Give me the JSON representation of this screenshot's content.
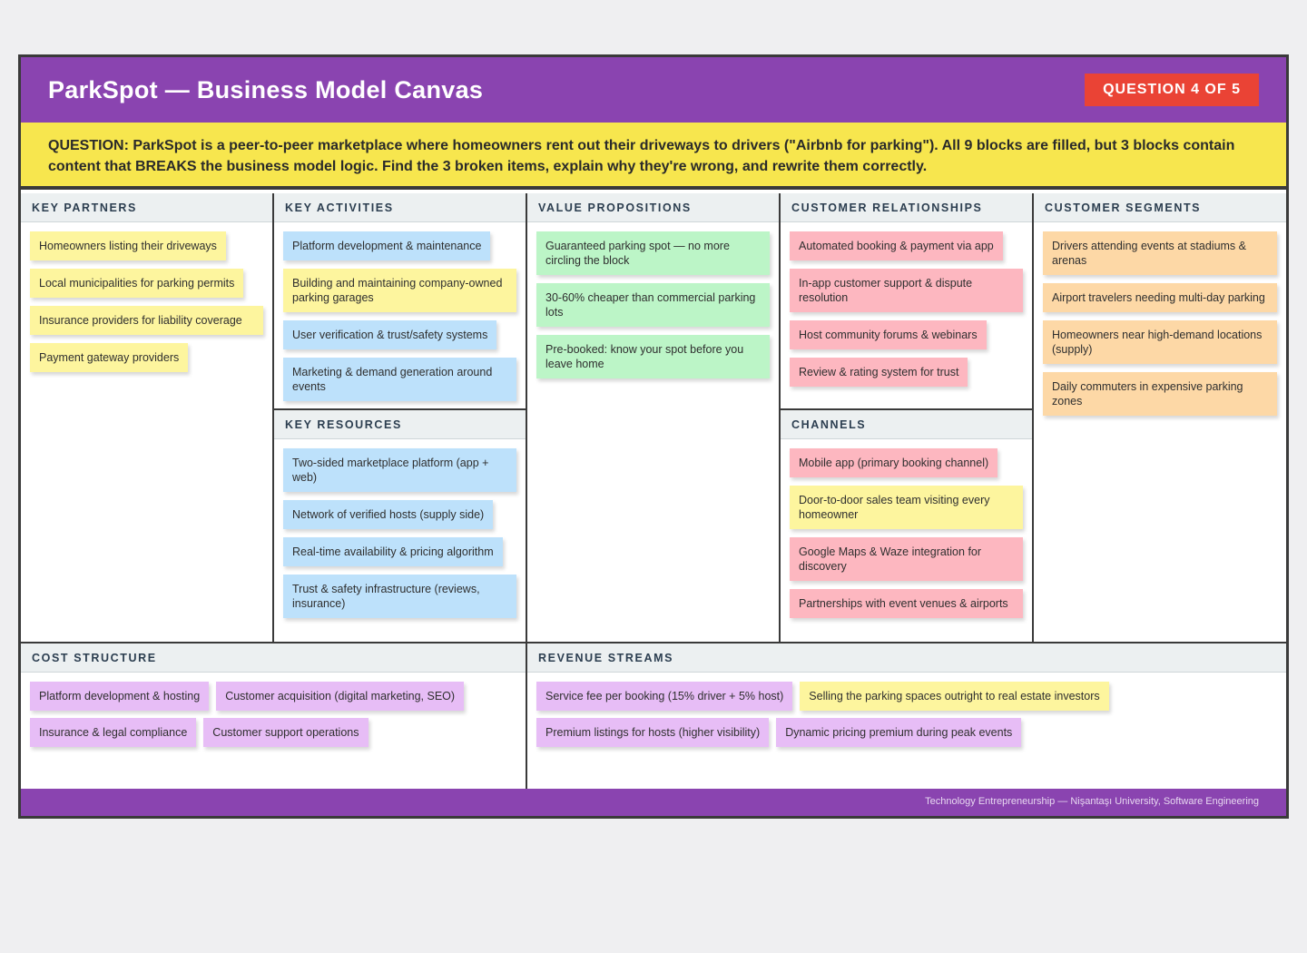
{
  "header": {
    "title": "ParkSpot — Business Model Canvas",
    "badge": "QUESTION 4 OF 5"
  },
  "question": "QUESTION: ParkSpot is a peer-to-peer marketplace where homeowners rent out their driveways to drivers (\"Airbnb for parking\"). All 9 blocks are filled, but 3 blocks contain content that BREAKS the business model logic. Find the 3 broken items, explain why they're wrong, and rewrite them correctly.",
  "blocks": {
    "key_partners": {
      "title": "KEY PARTNERS",
      "notes": [
        "Homeowners listing their driveways",
        "Local municipalities for parking permits",
        "Insurance providers for liability coverage",
        "Payment gateway providers"
      ]
    },
    "key_activities": {
      "title": "KEY ACTIVITIES",
      "notes": [
        "Platform development & maintenance",
        "Building and maintaining company-owned parking garages",
        "User verification & trust/safety systems",
        "Marketing & demand generation around events"
      ]
    },
    "key_resources": {
      "title": "KEY RESOURCES",
      "notes": [
        "Two-sided marketplace platform (app + web)",
        "Network of verified hosts (supply side)",
        "Real-time availability & pricing algorithm",
        "Trust & safety infrastructure (reviews, insurance)"
      ]
    },
    "value_propositions": {
      "title": "VALUE PROPOSITIONS",
      "notes": [
        "Guaranteed parking spot — no more circling the block",
        "30-60% cheaper than commercial parking lots",
        "Pre-booked: know your spot before you leave home"
      ]
    },
    "customer_relationships": {
      "title": "CUSTOMER RELATIONSHIPS",
      "notes": [
        "Automated booking & payment via app",
        "In-app customer support & dispute resolution",
        "Host community forums & webinars",
        "Review & rating system for trust"
      ]
    },
    "channels": {
      "title": "CHANNELS",
      "notes": [
        "Mobile app (primary booking channel)",
        "Door-to-door sales team visiting every homeowner",
        "Google Maps & Waze integration for discovery",
        "Partnerships with event venues & airports"
      ]
    },
    "customer_segments": {
      "title": "CUSTOMER SEGMENTS",
      "notes": [
        "Drivers attending events at stadiums & arenas",
        "Airport travelers needing multi-day parking",
        "Homeowners near high-demand locations (supply)",
        "Daily commuters in expensive parking zones"
      ]
    },
    "cost_structure": {
      "title": "COST STRUCTURE",
      "notes": [
        "Platform development & hosting",
        "Customer acquisition (digital marketing, SEO)",
        "Insurance & legal compliance",
        "Customer support operations"
      ]
    },
    "revenue_streams": {
      "title": "REVENUE STREAMS",
      "notes": [
        "Service fee per booking (15% driver + 5% host)",
        "Selling the parking spaces outright to real estate investors",
        "Premium listings for hosts (higher visibility)",
        "Dynamic pricing premium during peak events"
      ]
    }
  },
  "footer": "Technology Entrepreneurship — Nişantaşı University, Software Engineering",
  "colors": {
    "header_bg": "#8a44b0",
    "question_bg": "#f7e64e",
    "badge_bg": "#ea4335",
    "note_yellow": "#fdf59e",
    "note_blue": "#bde1fb",
    "note_green": "#bcf5c7",
    "note_pink": "#fdb7c0",
    "note_orange": "#fdd8a6",
    "note_violet": "#e7bdf6"
  }
}
